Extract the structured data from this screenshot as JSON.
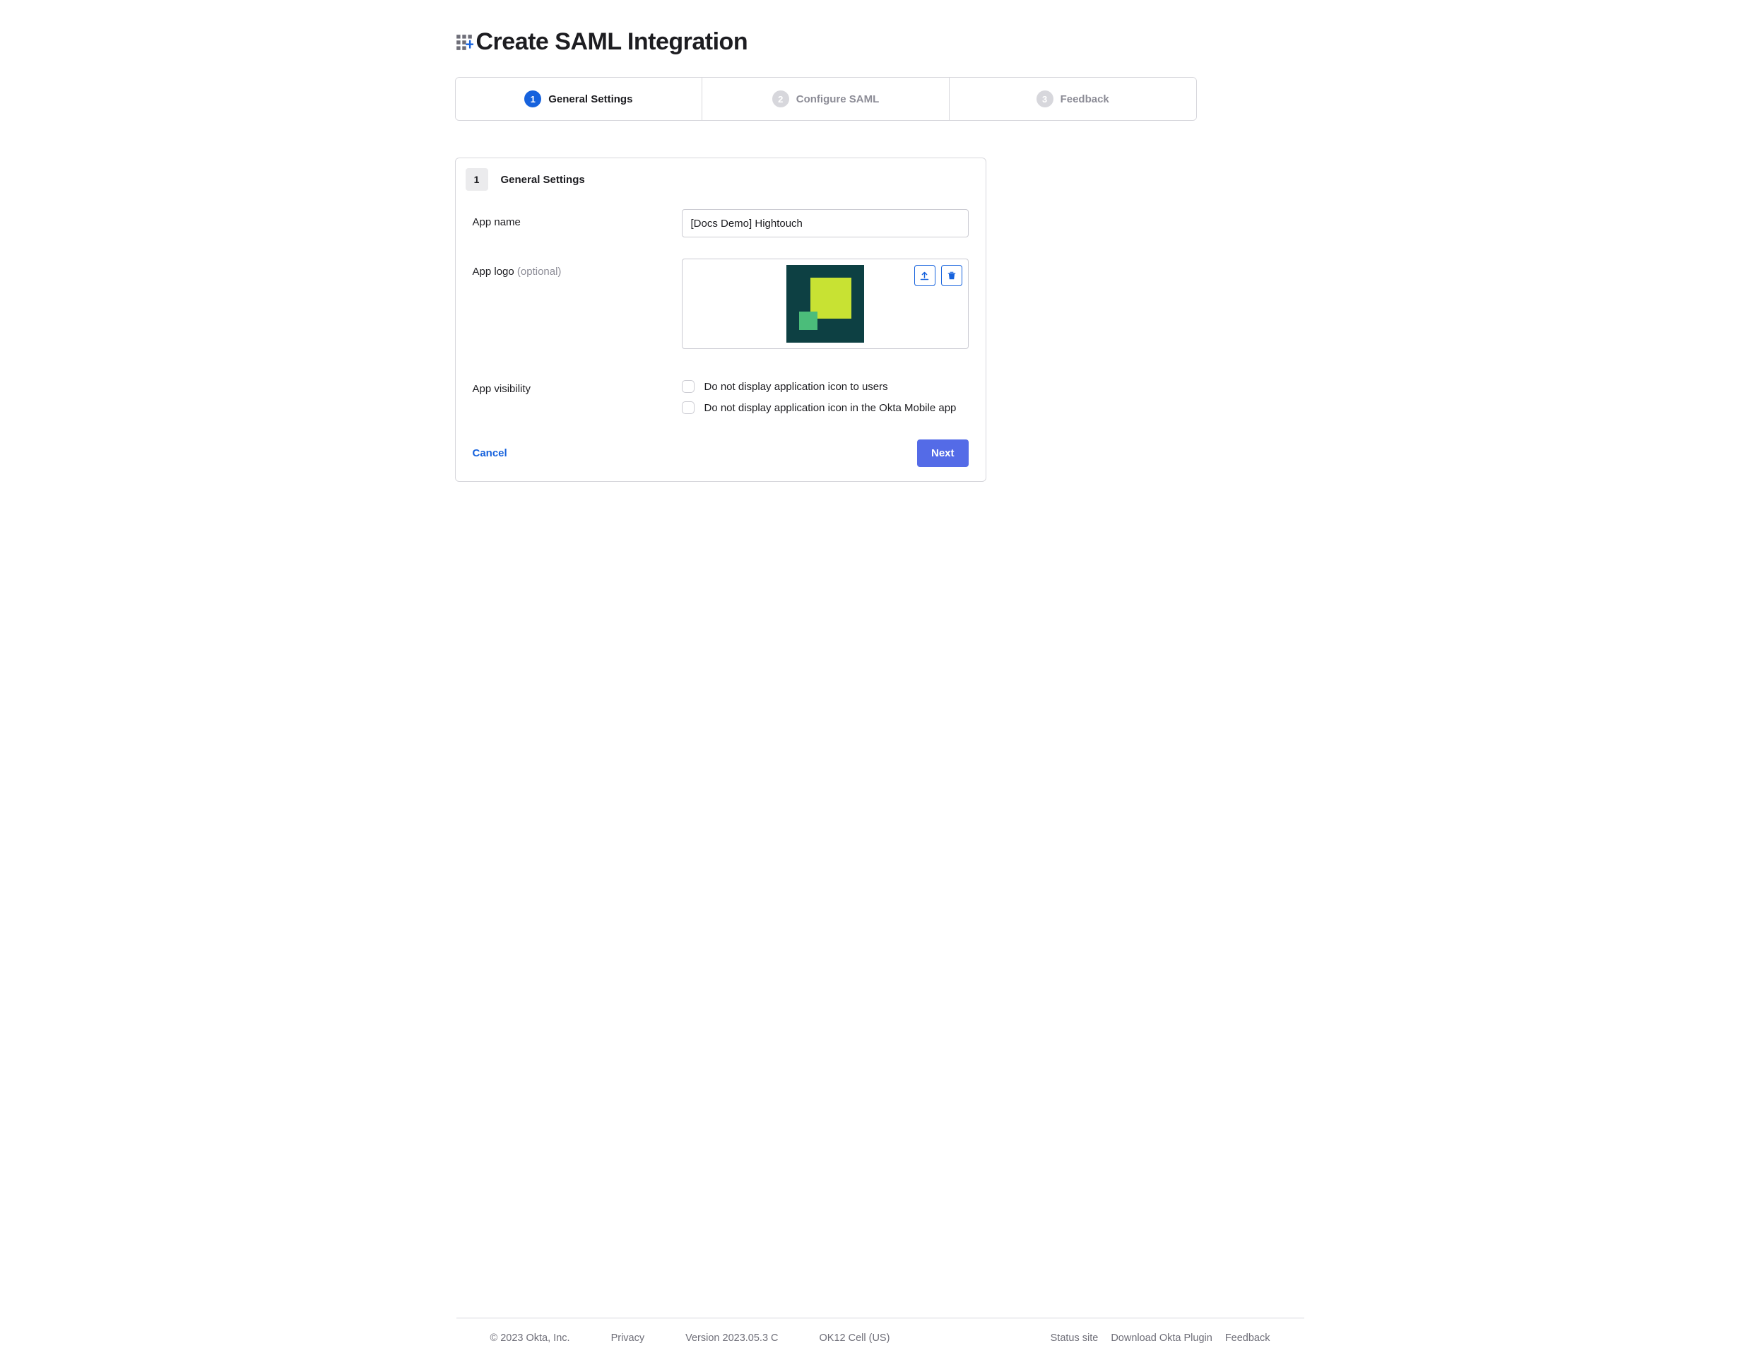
{
  "header": {
    "title": "Create SAML Integration"
  },
  "wizard": {
    "tabs": [
      {
        "num": "1",
        "label": "General Settings",
        "active": true
      },
      {
        "num": "2",
        "label": "Configure SAML",
        "active": false
      },
      {
        "num": "3",
        "label": "Feedback",
        "active": false
      }
    ]
  },
  "panel": {
    "step_num": "1",
    "title": "General Settings",
    "labels": {
      "app_name": "App name",
      "app_logo": "App logo ",
      "app_logo_optional": "(optional)",
      "app_visibility": "App visibility"
    },
    "fields": {
      "app_name_value": "[Docs Demo] Hightouch"
    },
    "checkboxes": {
      "hide_users": "Do not display application icon to users",
      "hide_mobile": "Do not display application icon in the Okta Mobile app"
    },
    "buttons": {
      "cancel": "Cancel",
      "next": "Next"
    }
  },
  "footer": {
    "copyright": "© 2023 Okta, Inc.",
    "privacy": "Privacy",
    "version": "Version 2023.05.3 C",
    "cell": "OK12 Cell (US)",
    "status": "Status site",
    "download": "Download Okta Plugin",
    "feedback": "Feedback"
  }
}
